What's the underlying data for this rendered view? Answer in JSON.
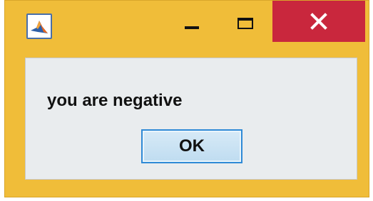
{
  "window": {
    "accent_color": "#f0bd39",
    "close_button_color": "#c9273d",
    "app_icon": "matlab-icon",
    "controls": {
      "minimize_icon": "minimize-icon",
      "maximize_icon": "maximize-icon",
      "close_icon": "close-icon"
    }
  },
  "dialog": {
    "message": "you are negative",
    "ok_label": "OK"
  }
}
